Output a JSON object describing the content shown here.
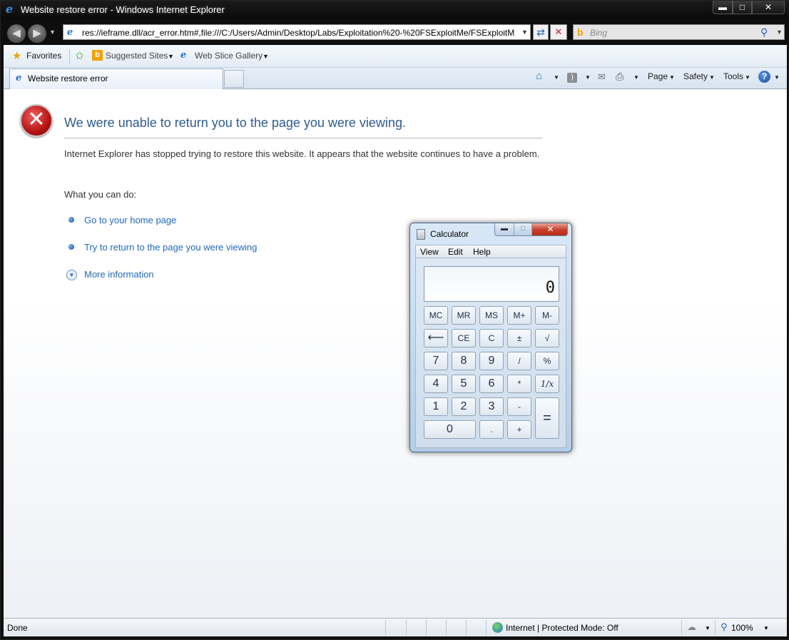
{
  "window": {
    "title": "Website restore error - Windows Internet Explorer",
    "min_glyph": "▬",
    "max_glyph": "□",
    "close_glyph": "✕"
  },
  "address": {
    "url": "res://ieframe.dll/acr_error.htm#,file:///C:/Users/Admin/Desktop/Labs/Exploitation%20-%20FSExploitMe/FSExploitM"
  },
  "search": {
    "placeholder": "Bing"
  },
  "favorites_bar": {
    "favorites_label": "Favorites",
    "suggested_sites_label": "Suggested Sites",
    "web_slice_gallery_label": "Web Slice Gallery"
  },
  "tabs": [
    {
      "label": "Website restore error"
    }
  ],
  "command_bar": {
    "page_label": "Page",
    "safety_label": "Safety",
    "tools_label": "Tools",
    "help_label": "?"
  },
  "error_page": {
    "title": "We were unable to return you to the page you were viewing.",
    "description": "Internet Explorer has stopped trying to restore this website. It appears that the website continues to have a problem.",
    "what_you_can_do": "What you can do:",
    "links": [
      {
        "label": "Go to your home page"
      },
      {
        "label": "Try to return to the page you were viewing"
      },
      {
        "label": "More information"
      }
    ]
  },
  "status_bar": {
    "status": "Done",
    "zone": "Internet | Protected Mode: Off",
    "zoom": "100%"
  },
  "calculator": {
    "title": "Calculator",
    "menu": [
      "View",
      "Edit",
      "Help"
    ],
    "display": "0",
    "keys": {
      "mc": "MC",
      "mr": "MR",
      "ms": "MS",
      "mplus": "M+",
      "mminus": "M-",
      "back": "⟵",
      "ce": "CE",
      "c": "C",
      "plusminus": "±",
      "sqrt": "√",
      "k7": "7",
      "k8": "8",
      "k9": "9",
      "div": "/",
      "pct": "%",
      "k4": "4",
      "k5": "5",
      "k6": "6",
      "mul": "*",
      "recip": "1/x",
      "k1": "1",
      "k2": "2",
      "k3": "3",
      "sub": "-",
      "eq": "=",
      "k0": "0",
      "dot": ".",
      "add": "+"
    }
  }
}
